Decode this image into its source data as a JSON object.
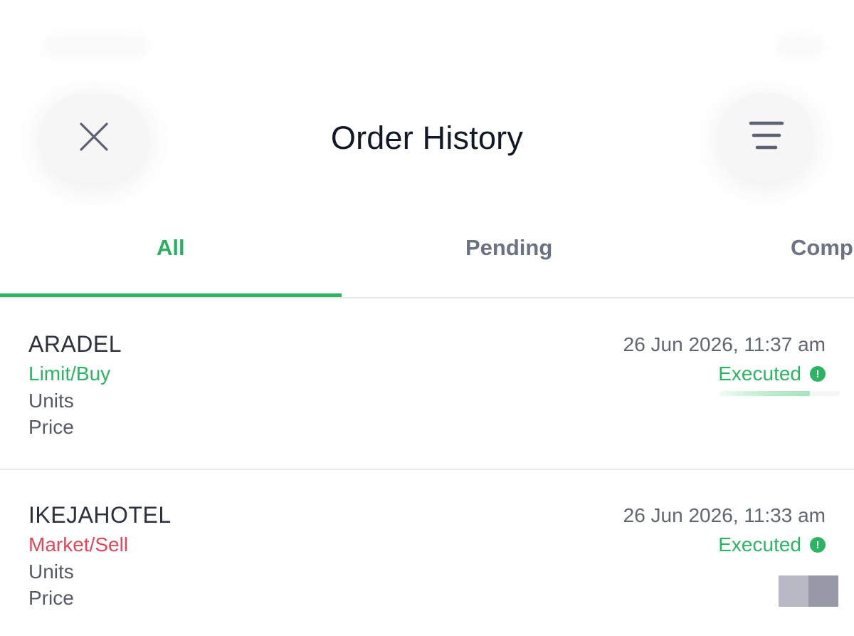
{
  "header": {
    "title": "Order History",
    "close_icon": "close-icon",
    "filter_icon": "filter-lines-icon"
  },
  "tabs": [
    {
      "label": "All",
      "active": true
    },
    {
      "label": "Pending",
      "active": false
    },
    {
      "label": "Comp",
      "active": false
    }
  ],
  "orders": [
    {
      "symbol": "ARADEL",
      "order_type": "Limit/Buy",
      "side_color": "#2bb563",
      "units_label": "Units",
      "price_label": "Price",
      "datetime": "26 Jun 2026, 11:37 am",
      "status": "Executed",
      "status_icon": "exclamation-circle-icon",
      "fill_progress": 0.75
    },
    {
      "symbol": "IKEJAHOTEL",
      "order_type": "Market/Sell",
      "side_color": "#e0485a",
      "units_label": "Units",
      "price_label": "Price",
      "datetime": "26 Jun 2026, 11:33 am",
      "status": "Executed",
      "status_icon": "exclamation-circle-icon"
    }
  ],
  "colors": {
    "accent": "#2bb563",
    "sell": "#e0485a",
    "title": "#111827",
    "muted": "#6b7280"
  }
}
